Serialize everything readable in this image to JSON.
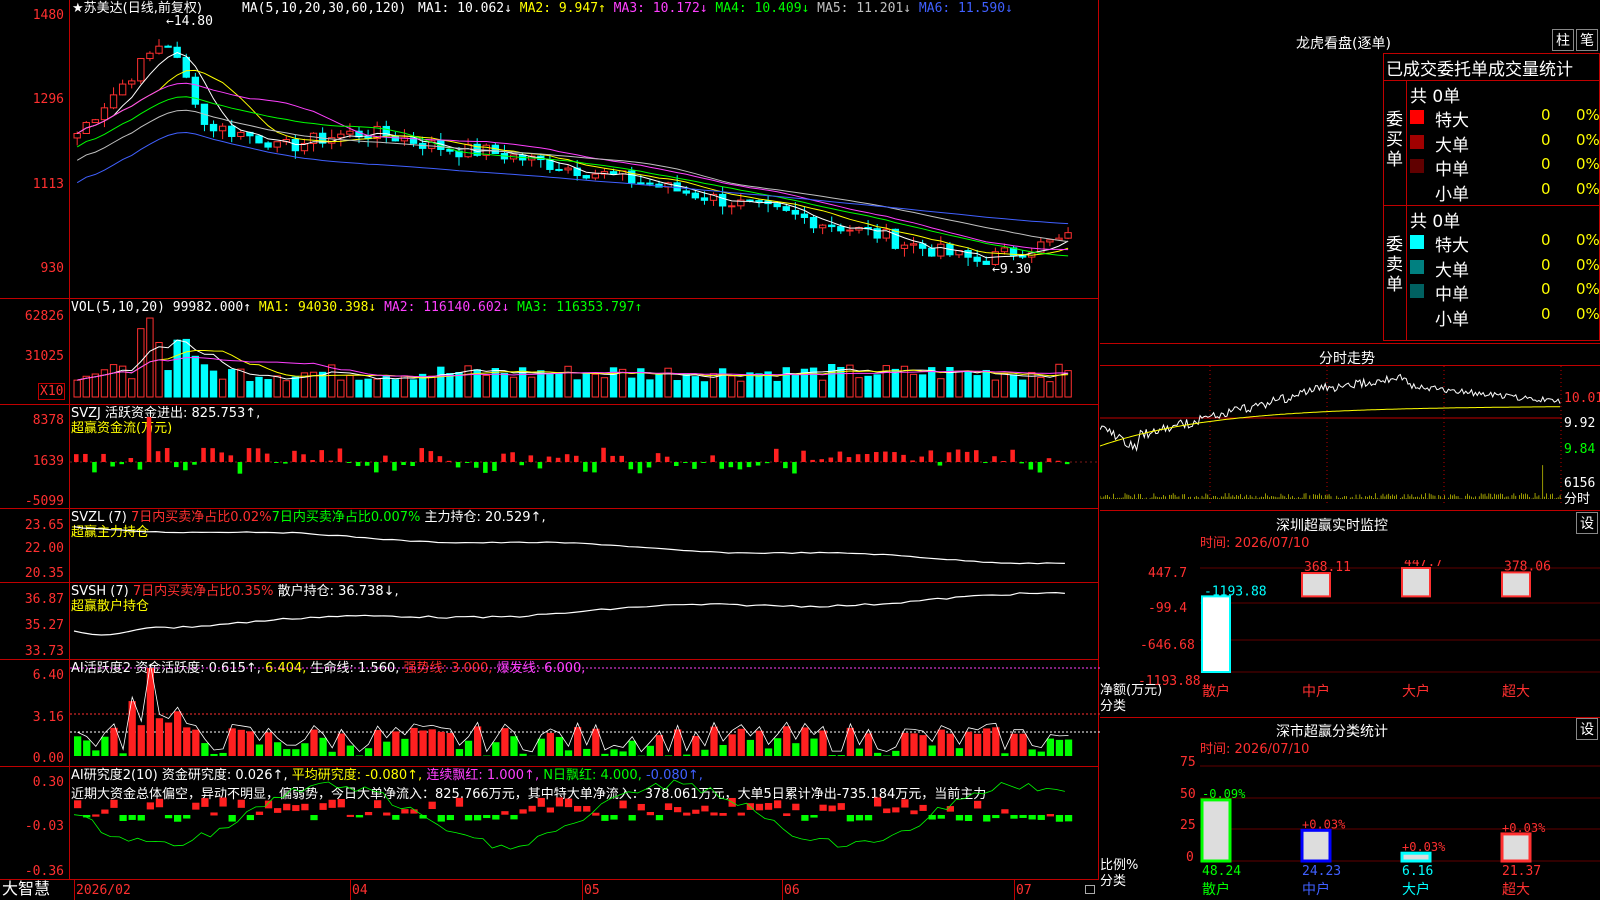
{
  "main": {
    "title": "★苏美达(日线,前复权)",
    "ma_label": "MA(5,10,20,30,60,120)",
    "ma_values": [
      {
        "name": "MA1",
        "text": "MA1: 10.062↓",
        "color": "#ffffff"
      },
      {
        "name": "MA2",
        "text": "MA2: 9.947↑",
        "color": "#ffff00"
      },
      {
        "name": "MA3",
        "text": "MA3: 10.172↓",
        "color": "#ff40ff"
      },
      {
        "name": "MA4",
        "text": "MA4: 10.409↓",
        "color": "#00ff00"
      },
      {
        "name": "MA5",
        "text": "MA5: 11.201↓",
        "color": "#c0c0c0"
      },
      {
        "name": "MA6",
        "text": "MA6: 11.590↓",
        "color": "#4060ff"
      }
    ],
    "y_ticks": [
      "1480",
      "1296",
      "1113",
      "930"
    ],
    "high_label": "14.80",
    "low_label": "9.30"
  },
  "vol": {
    "label": "VOL(5,10,20)",
    "value": "99982.000↑",
    "ma1": "MA1: 94030.398↓",
    "ma2": "MA2: 116140.602↓",
    "ma3": "MA3: 116353.797↑",
    "y_ticks": [
      "62826",
      "31025"
    ],
    "unit": "X10"
  },
  "svzj": {
    "label": "SVZJ  活跃资金进出: 825.753↑,",
    "sub": "超赢资金流(万元)",
    "y_ticks": [
      "8378",
      "1639",
      "-5099"
    ]
  },
  "svzl": {
    "label": "SVZL (7)",
    "t1": "7日内买卖净占比0.02%",
    "t2": "7日内买卖净占比0.007%",
    "t3": "主力持仓: 20.529↑,",
    "sub": "超赢主力持仓",
    "y_ticks": [
      "23.65",
      "22.00",
      "20.35"
    ]
  },
  "svsh": {
    "label": "SVSH (7)",
    "t1": "7日内买卖净占比0.35%",
    "t2": "散户持仓: 36.738↓,",
    "sub": "超赢散户持仓",
    "y_ticks": [
      "36.87",
      "35.27",
      "33.73"
    ]
  },
  "ai1": {
    "label": "AI活跃度2",
    "t1": "资金活跃度: 0.615↑,",
    "t2": "6.404,",
    "t3": "生命线: 1.560,",
    "t4": "强势线: 3.000,",
    "t5": "爆发线: 6.000,",
    "y_ticks": [
      "6.40",
      "3.16",
      "0.00"
    ]
  },
  "ai2": {
    "label": "AI研究度2(10)",
    "t1": "资金研究度: 0.026↑,",
    "t2": "平均研究度: -0.080↑,",
    "t3": "连续飘红: 1.000↑,",
    "t4": "N日飘红: 4.000,",
    "t5": "-0.080↑,",
    "comment": "近期大资金总体偏空，异动不明显，偏弱势，今日大单净流入：825.766万元，其中特大单净流入：378.061万元，大单5日累计净出-735.184万元，当前主力",
    "y_ticks": [
      "0.30",
      "-0.03",
      "-0.36"
    ]
  },
  "xaxis": {
    "brand": "大智慧",
    "labels": [
      "2026/02",
      "04",
      "05",
      "06",
      "07"
    ]
  },
  "right": {
    "dragon_title": "龙虎看盘(逐单)",
    "btn_zhu": "柱",
    "btn_bi": "笔",
    "stat_title": "已成交委托单成交量统计",
    "buy": {
      "label": "委买单",
      "total": "共 0单",
      "rows": [
        {
          "name": "特大",
          "v": "0",
          "p": "0%",
          "color": "#ff0000"
        },
        {
          "name": "大单",
          "v": "0",
          "p": "0%",
          "color": "#a00000"
        },
        {
          "name": "中单",
          "v": "0",
          "p": "0%",
          "color": "#600000"
        },
        {
          "name": "小单",
          "v": "0",
          "p": "0%",
          "color": "#000000"
        }
      ]
    },
    "sell": {
      "label": "委卖单",
      "total": "共 0单",
      "rows": [
        {
          "name": "特大",
          "v": "0",
          "p": "0%",
          "color": "#00ffff"
        },
        {
          "name": "大单",
          "v": "0",
          "p": "0%",
          "color": "#008080"
        },
        {
          "name": "中单",
          "v": "0",
          "p": "0%",
          "color": "#006060"
        },
        {
          "name": "小单",
          "v": "0",
          "p": "0%",
          "color": "#000000"
        }
      ]
    },
    "intraday": {
      "title": "分时走势",
      "y": [
        "10.01",
        "9.92",
        "9.84"
      ],
      "vol": "6156",
      "vol_unit": "分时"
    },
    "sz_monitor": {
      "title": "深圳超赢实时监控",
      "btn": "设",
      "time": "时间: 2026/07/10",
      "y": [
        "447.7",
        "-99.4",
        "-646.68",
        "-1193.88"
      ],
      "ylabel": "净额(万元)",
      "xlabel": "分类",
      "cats": [
        "散户",
        "中户",
        "大户",
        "超大"
      ],
      "vals": [
        "-1193.88",
        "368.11",
        "447.7",
        "378.06"
      ]
    },
    "sz_stats": {
      "title": "深市超赢分类统计",
      "btn": "设",
      "time": "时间: 2026/07/10",
      "y": [
        "75",
        "50",
        "25",
        "0"
      ],
      "ylabel": "比例%",
      "xlabel": "分类",
      "cats": [
        "散户",
        "中户",
        "大户",
        "超大"
      ],
      "vals": [
        "48.24",
        "24.23",
        "6.16",
        "21.37"
      ],
      "deltas": [
        "-0.09%",
        "+0.03%",
        "+0.03%",
        "+0.03%"
      ]
    }
  },
  "chart_data": [
    {
      "type": "candlestick",
      "title": "苏美达(日线,前复权)",
      "x_range": [
        "2026/02",
        "07"
      ],
      "ylim": [
        9.3,
        14.8
      ],
      "annotations": {
        "high": 14.8,
        "low": 9.3
      }
    },
    {
      "type": "bar",
      "title": "VOL(5,10,20)",
      "ylim": [
        0,
        62826
      ]
    },
    {
      "type": "bar",
      "title": "深圳超赢实时监控",
      "categories": [
        "散户",
        "中户",
        "大户",
        "超大"
      ],
      "values": [
        -1193.88,
        368.11,
        447.7,
        378.06
      ],
      "ylabel": "净额(万元)"
    },
    {
      "type": "bar",
      "title": "深市超赢分类统计",
      "categories": [
        "散户",
        "中户",
        "大户",
        "超大"
      ],
      "values": [
        48.24,
        24.23,
        6.16,
        21.37
      ],
      "ylabel": "比例%",
      "ylim": [
        0,
        75
      ]
    }
  ]
}
